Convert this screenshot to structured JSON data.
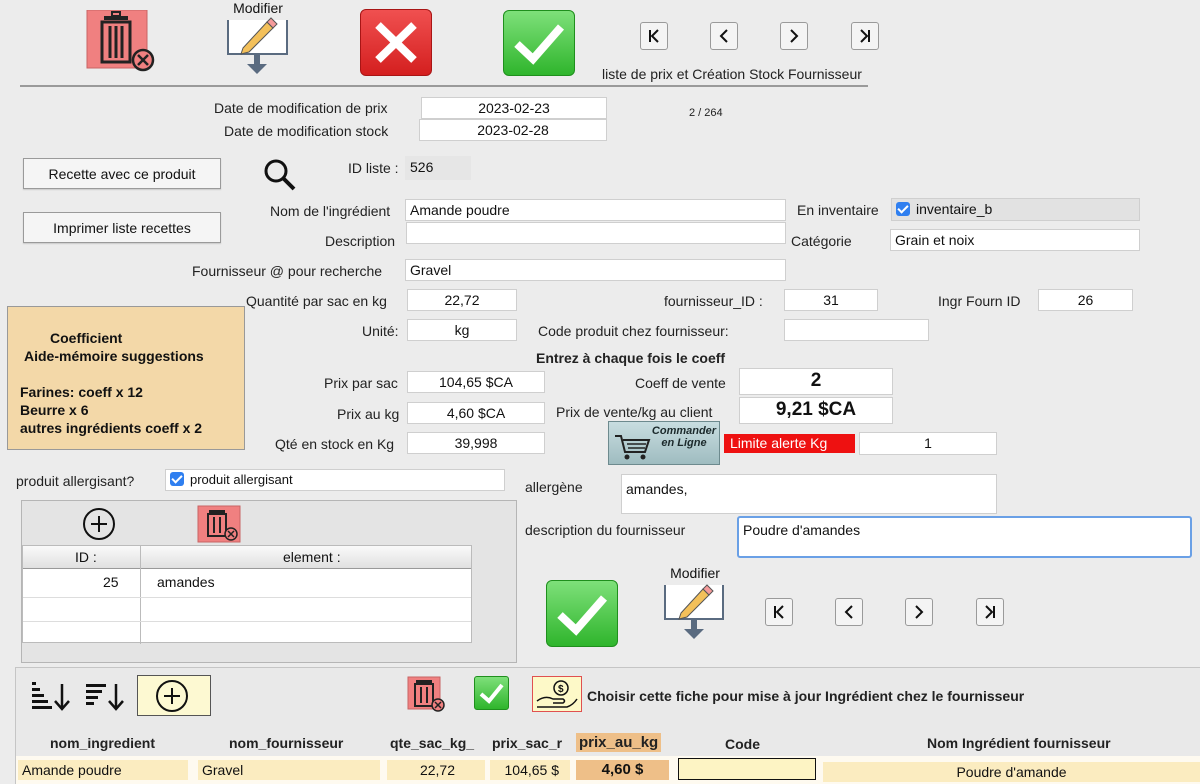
{
  "toolbar": {
    "modifier_label": "Modifier",
    "nav_title": "liste de prix et Création Stock Fournisseur",
    "record_counter": "2 / 264"
  },
  "dates": {
    "price_label": "Date de modification de prix",
    "price_value": "2023-02-23",
    "stock_label": "Date de modification stock",
    "stock_value": "2023-02-28"
  },
  "buttons": {
    "recipe": "Recette avec ce produit",
    "print": "Imprimer liste recettes"
  },
  "form": {
    "id_liste_label": "ID liste :",
    "id_liste_value": "526",
    "nom_label": "Nom de l'ingrédient",
    "nom_value": "Amande poudre",
    "description_label": "Description",
    "description_value": "",
    "en_inventaire_label": "En inventaire",
    "inventaire_checkbox_label": "inventaire_b",
    "categorie_label": "Catégorie",
    "categorie_value": "Grain et noix",
    "fournisseur_label": "Fournisseur @ pour recherche",
    "fournisseur_value": "Gravel",
    "qte_sac_label": "Quantité par sac en kg",
    "qte_sac_value": "22,72",
    "fournisseur_id_label": "fournisseur_ID :",
    "fournisseur_id_value": "31",
    "ingr_fourn_label": "Ingr Fourn ID",
    "ingr_fourn_value": "26",
    "unite_label": "Unité:",
    "unite_value": "kg",
    "code_produit_label": "Code produit chez fournisseur:",
    "code_produit_value": "",
    "coeff_notice": "Entrez à chaque fois le coeff",
    "prix_sac_label": "Prix par sac",
    "prix_sac_value": "104,65 $CA",
    "coeff_vente_label": "Coeff de vente",
    "coeff_vente_value": "2",
    "prix_kg_label": "Prix au kg",
    "prix_kg_value": "4,60 $CA",
    "prix_vente_label": "Prix de vente/kg au client",
    "prix_vente_value": "9,21 $CA",
    "stock_label": "Qté en stock en Kg",
    "stock_value": "39,998",
    "commander_label": "Commander en Ligne",
    "limite_label": "Limite alerte Kg",
    "limite_value": "1"
  },
  "memo": {
    "title1": "Coefficient",
    "title2": "Aide-mémoire suggestions",
    "line1": "Farines: coeff x 12",
    "line2": "Beurre x 6",
    "line3": "autres ingrédients coeff x 2"
  },
  "allergen": {
    "question_label": "produit allergisant?",
    "checkbox_label": "produit allergisant",
    "allergene_label": "allergène",
    "allergene_value": "amandes,",
    "desc_fourn_label": "description du fournisseur",
    "desc_fourn_value": "Poudre d'amandes",
    "table_headers": [
      "ID :",
      "element :"
    ],
    "table_rows": [
      {
        "id": "25",
        "element": "amandes"
      }
    ]
  },
  "bottom": {
    "modifier_label": "Modifier",
    "choose_label": "Choisir cette fiche pour mise à jour Ingrédient chez le fournisseur",
    "columns": [
      "nom_ingredient",
      "nom_fournisseur",
      "qte_sac_kg_",
      "prix_sac_r",
      "prix_au_kg",
      "Code",
      "Nom Ingrédient fournisseur"
    ],
    "row": {
      "nom_ingredient": "Amande poudre",
      "nom_fournisseur": "Gravel",
      "qte_sac": "22,72",
      "prix_sac": "104,65 $",
      "prix_kg": "4,60 $",
      "code": "",
      "nom_fourn": "Poudre d'amande"
    }
  },
  "colors": {
    "delete_red": "#f08080",
    "cancel_red": "#e02d2d",
    "ok_green": "#3cbf38",
    "memo_bg": "#f3d8a8",
    "alert_red": "#ee1111",
    "row_yellow": "#fbecc0"
  }
}
